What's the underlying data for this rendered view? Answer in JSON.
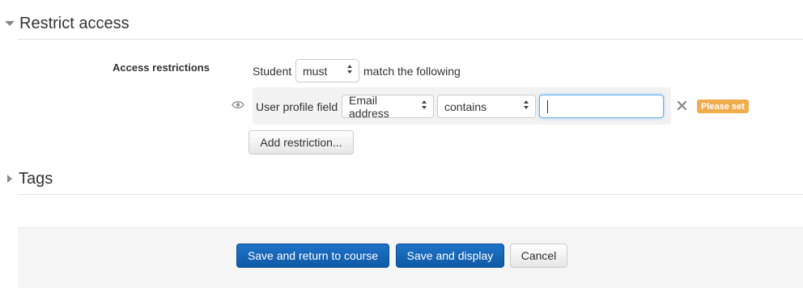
{
  "restrict_access": {
    "title": "Restrict access",
    "label": "Access restrictions",
    "student_prefix": "Student",
    "must_select": "must",
    "match_suffix": "match the following",
    "condition": {
      "field_label": "User profile field",
      "field_select": "Email address",
      "operator_select": "contains",
      "value": "",
      "status_badge": "Please set"
    },
    "add_restriction_label": "Add restriction..."
  },
  "tags": {
    "title": "Tags"
  },
  "footer": {
    "save_return_label": "Save and return to course",
    "save_display_label": "Save and display",
    "cancel_label": "Cancel"
  },
  "colors": {
    "primary": "#1e73c8",
    "warning_badge": "#f0ad4e",
    "focus_border": "#66afe9"
  },
  "icons": {
    "section_toggle_open": "chevron-down-icon",
    "section_toggle_closed": "chevron-right-icon",
    "visibility": "eye-icon",
    "delete": "close-icon"
  }
}
